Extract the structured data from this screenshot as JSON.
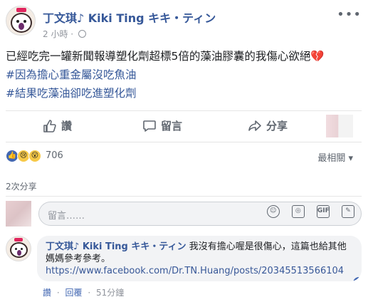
{
  "post": {
    "author": "丁文琪♪ Kiki Ting キキ・ティン",
    "time": "2 小時",
    "body_line1": "已經吃完一罐新聞報導塑化劑超標5倍的藻油膠囊的我傷心欲絕",
    "emoji": "💔",
    "hashtag1": "#因為擔心重金屬沒吃魚油",
    "hashtag2": "#結果吃藻油卻吃進塑化劑"
  },
  "actions": {
    "like": "讚",
    "comment": "留言",
    "share": "分享"
  },
  "reactions": {
    "count": "706",
    "sort": "最相關 ▾",
    "types": [
      "like",
      "sad",
      "wow"
    ]
  },
  "shares": "2次分享",
  "composer": {
    "placeholder": "留言……",
    "icons": [
      "emoji-icon",
      "camera-icon",
      "gif-icon",
      "sticker-icon"
    ]
  },
  "comment": {
    "author": "丁文琪♪ Kiki Ting キキ・ティン",
    "text": "我沒有擔心喔是很傷心，這篇也給其他媽媽參考參考。",
    "link": "https://www.facebook.com/Dr.TN.Huang/posts/20345513566104",
    "like": "讚",
    "reply": "回覆",
    "time": "51分鐘"
  },
  "colors": {
    "link": "#365899",
    "accent": "#4267b2",
    "muted": "#606770"
  }
}
